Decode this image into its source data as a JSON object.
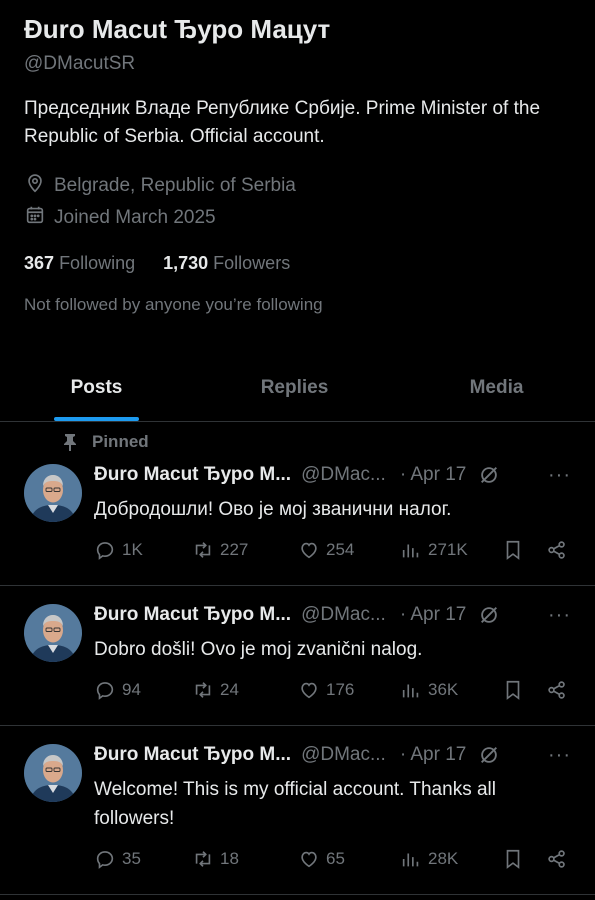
{
  "profile": {
    "display_name": "Đuro Macut Ђуро Мацут",
    "handle": "@DMacutSR",
    "bio": "Председник Владе Републике Србије. Prime Minister of the Republic of Serbia. Official account.",
    "location": "Belgrade, Republic of Serbia",
    "joined": "Joined March 2025",
    "following_count": "367",
    "following_label": "Following",
    "followers_count": "1,730",
    "followers_label": "Followers",
    "not_followed_text": "Not followed by anyone you’re following"
  },
  "tabs": [
    {
      "label": "Posts",
      "active": true
    },
    {
      "label": "Replies",
      "active": false
    },
    {
      "label": "Media",
      "active": false
    }
  ],
  "colors": {
    "accent": "#1d9bf0",
    "muted": "#71767b",
    "text": "#e7e9ea",
    "border": "#2f3336"
  },
  "posts": [
    {
      "pinned_label": "Pinned",
      "author": "Đuro Macut Ђуро М...",
      "handle": "@DMac...",
      "date": "· Apr 17",
      "more": "···",
      "text": "Добродошли! Ово је мој званични налог.",
      "replies": "1K",
      "reposts": "227",
      "likes": "254",
      "views": "271K"
    },
    {
      "author": "Đuro Macut Ђуро М...",
      "handle": "@DMac...",
      "date": "· Apr 17",
      "more": "···",
      "text": "Dobro došli! Ovo je moj zvanični nalog.",
      "replies": "94",
      "reposts": "24",
      "likes": "176",
      "views": "36K"
    },
    {
      "author": "Đuro Macut Ђуро М...",
      "handle": "@DMac...",
      "date": "· Apr 17",
      "more": "···",
      "text": "Welcome! This is my official account. Thanks all followers!",
      "replies": "35",
      "reposts": "18",
      "likes": "65",
      "views": "28K"
    }
  ]
}
